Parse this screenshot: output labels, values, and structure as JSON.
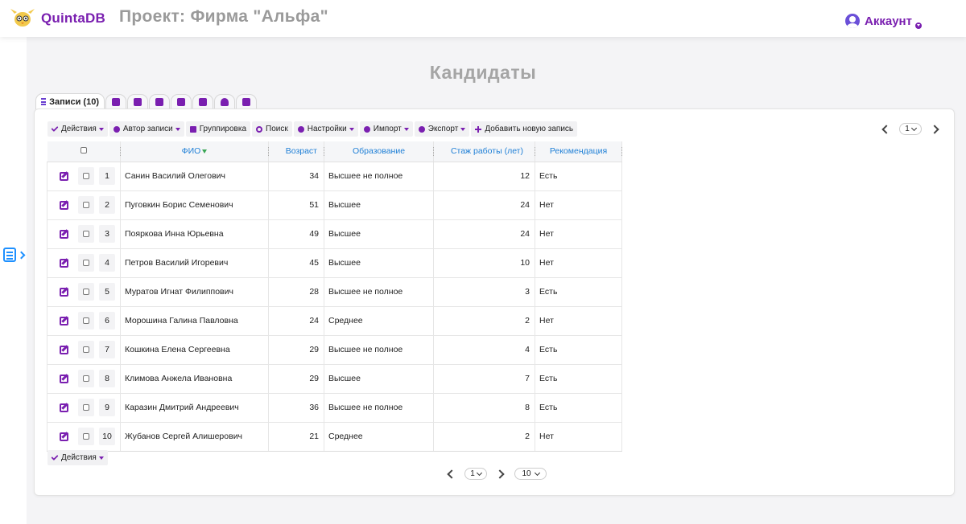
{
  "header": {
    "brand": "QuintaDB",
    "project_title": "Проект: Фирма \"Альфа\"",
    "account_label": "Аккаунт"
  },
  "page": {
    "heading": "Кандидаты"
  },
  "tabs": {
    "records_label": "Записи (10)"
  },
  "toolbar": {
    "actions": "Действия",
    "author": "Автор записи",
    "grouping": "Группировка",
    "search": "Поиск",
    "settings": "Настройки",
    "import": "Импорт",
    "export": "Экспорт",
    "add_record": "Добавить новую запись"
  },
  "pagination": {
    "current_page": "1",
    "per_page": "10"
  },
  "table": {
    "columns": [
      "ФИО",
      "Возраст",
      "Образование",
      "Стаж работы (лет)",
      "Рекомендация"
    ],
    "rows": [
      {
        "n": "1",
        "fio": "Санин Василий Олегович",
        "age": "34",
        "edu": "Высшее не полное",
        "exp": "12",
        "rec": "Есть"
      },
      {
        "n": "2",
        "fio": "Пуговкин Борис Семенович",
        "age": "51",
        "edu": "Высшее",
        "exp": "24",
        "rec": "Нет"
      },
      {
        "n": "3",
        "fio": "Пояркова Инна Юрьевна",
        "age": "49",
        "edu": "Высшее",
        "exp": "24",
        "rec": "Нет"
      },
      {
        "n": "4",
        "fio": "Петров Василий Игоревич",
        "age": "45",
        "edu": "Высшее",
        "exp": "10",
        "rec": "Нет"
      },
      {
        "n": "5",
        "fio": "Муратов Игнат Филиппович",
        "age": "28",
        "edu": "Высшее не полное",
        "exp": "3",
        "rec": "Есть"
      },
      {
        "n": "6",
        "fio": "Морошина Галина Павловна",
        "age": "24",
        "edu": "Среднее",
        "exp": "2",
        "rec": "Нет"
      },
      {
        "n": "7",
        "fio": "Кошкина Елена Сергеевна",
        "age": "29",
        "edu": "Высшее не полное",
        "exp": "4",
        "rec": "Есть"
      },
      {
        "n": "8",
        "fio": "Климова Анжела Ивановна",
        "age": "29",
        "edu": "Высшее",
        "exp": "7",
        "rec": "Есть"
      },
      {
        "n": "9",
        "fio": "Каразин Дмитрий Андреевич",
        "age": "36",
        "edu": "Высшее не полное",
        "exp": "8",
        "rec": "Есть"
      },
      {
        "n": "10",
        "fio": "Жубанов Сергей Алишерович",
        "age": "21",
        "edu": "Среднее",
        "exp": "2",
        "rec": "Нет"
      }
    ]
  },
  "bottom": {
    "actions": "Действия"
  },
  "colors": {
    "accent": "#7a1fb0",
    "link": "#1e7fd6",
    "heading": "#a5a5a5"
  }
}
